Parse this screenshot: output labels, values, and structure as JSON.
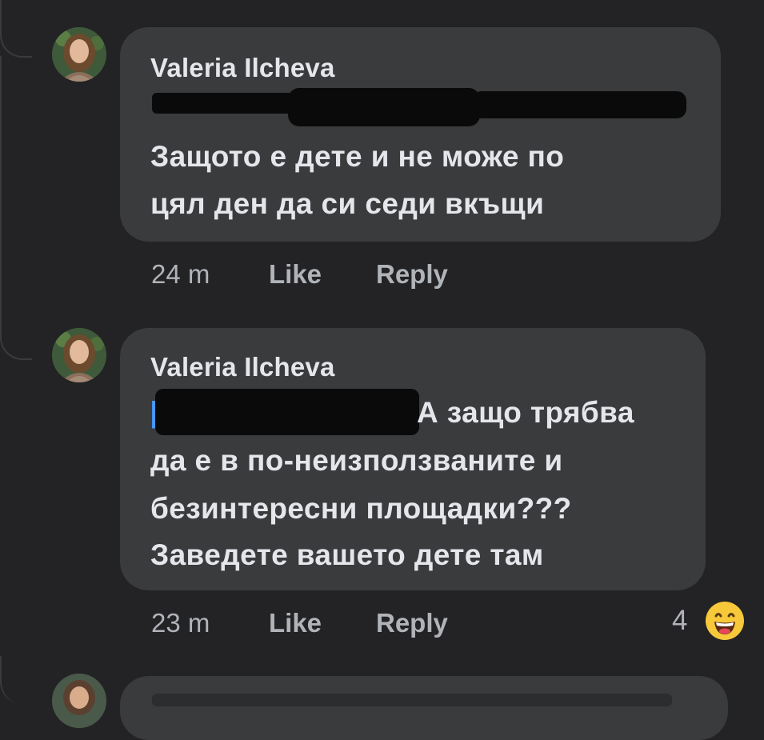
{
  "comments": [
    {
      "author": "Valeria Ilcheva",
      "text_line1": "Защото е дете и не може по",
      "text_line2": "цял ден да си седи вкъщи",
      "time": "24 m",
      "like": "Like",
      "reply": "Reply"
    },
    {
      "author": "Valeria Ilcheva",
      "mention_prefix": "[",
      "text_line1": "А защо трябва",
      "text_line2": "да е в по-неизползваните и",
      "text_line3": "безинтересни площадки???",
      "text_line4": "Заведете вашето дете там",
      "time": "23 m",
      "like": "Like",
      "reply": "Reply",
      "reaction_count": "4",
      "reaction_icon": "laughing-emoji-icon"
    }
  ],
  "colors": {
    "background": "#232325",
    "bubble": "#3a3b3c",
    "text": "#e4e6eb",
    "meta": "#b0b3b8",
    "mention": "#4599ff"
  }
}
